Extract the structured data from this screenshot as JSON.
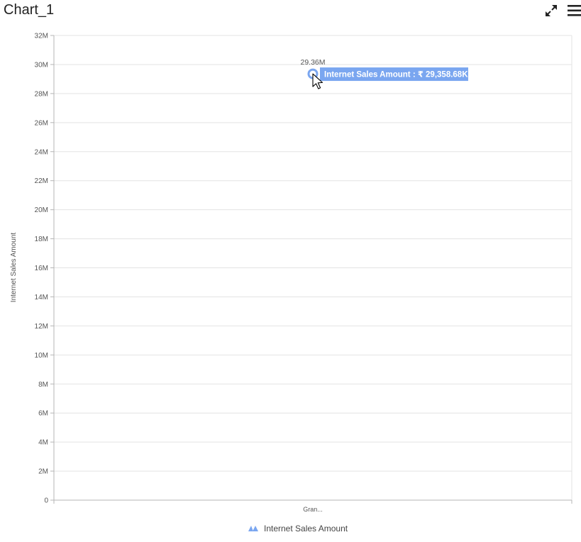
{
  "header": {
    "title": "Chart_1",
    "expand_icon": "expand-icon",
    "menu_icon": "hamburger-menu-icon"
  },
  "chart_data": {
    "type": "area",
    "categories": [
      "Gran..."
    ],
    "series": [
      {
        "name": "Internet Sales Amount",
        "values": [
          29358680
        ]
      }
    ],
    "xlabel": "",
    "ylabel": "Internet Sales Amount",
    "ylim": [
      0,
      32000000
    ],
    "yticks": [
      "0",
      "2M",
      "4M",
      "6M",
      "8M",
      "10M",
      "12M",
      "14M",
      "16M",
      "18M",
      "20M",
      "22M",
      "24M",
      "26M",
      "28M",
      "30M",
      "32M"
    ],
    "data_labels": [
      "29.36M"
    ],
    "grid": true,
    "legend": "bottom",
    "colors": {
      "series": "#7aa6f0",
      "grid": "#e3e3e3",
      "axis": "#b5b5b5",
      "tooltip": "#7aa6f0"
    },
    "tooltip": {
      "text": "Internet Sales Amount : ₹ 29,358.68K"
    }
  }
}
